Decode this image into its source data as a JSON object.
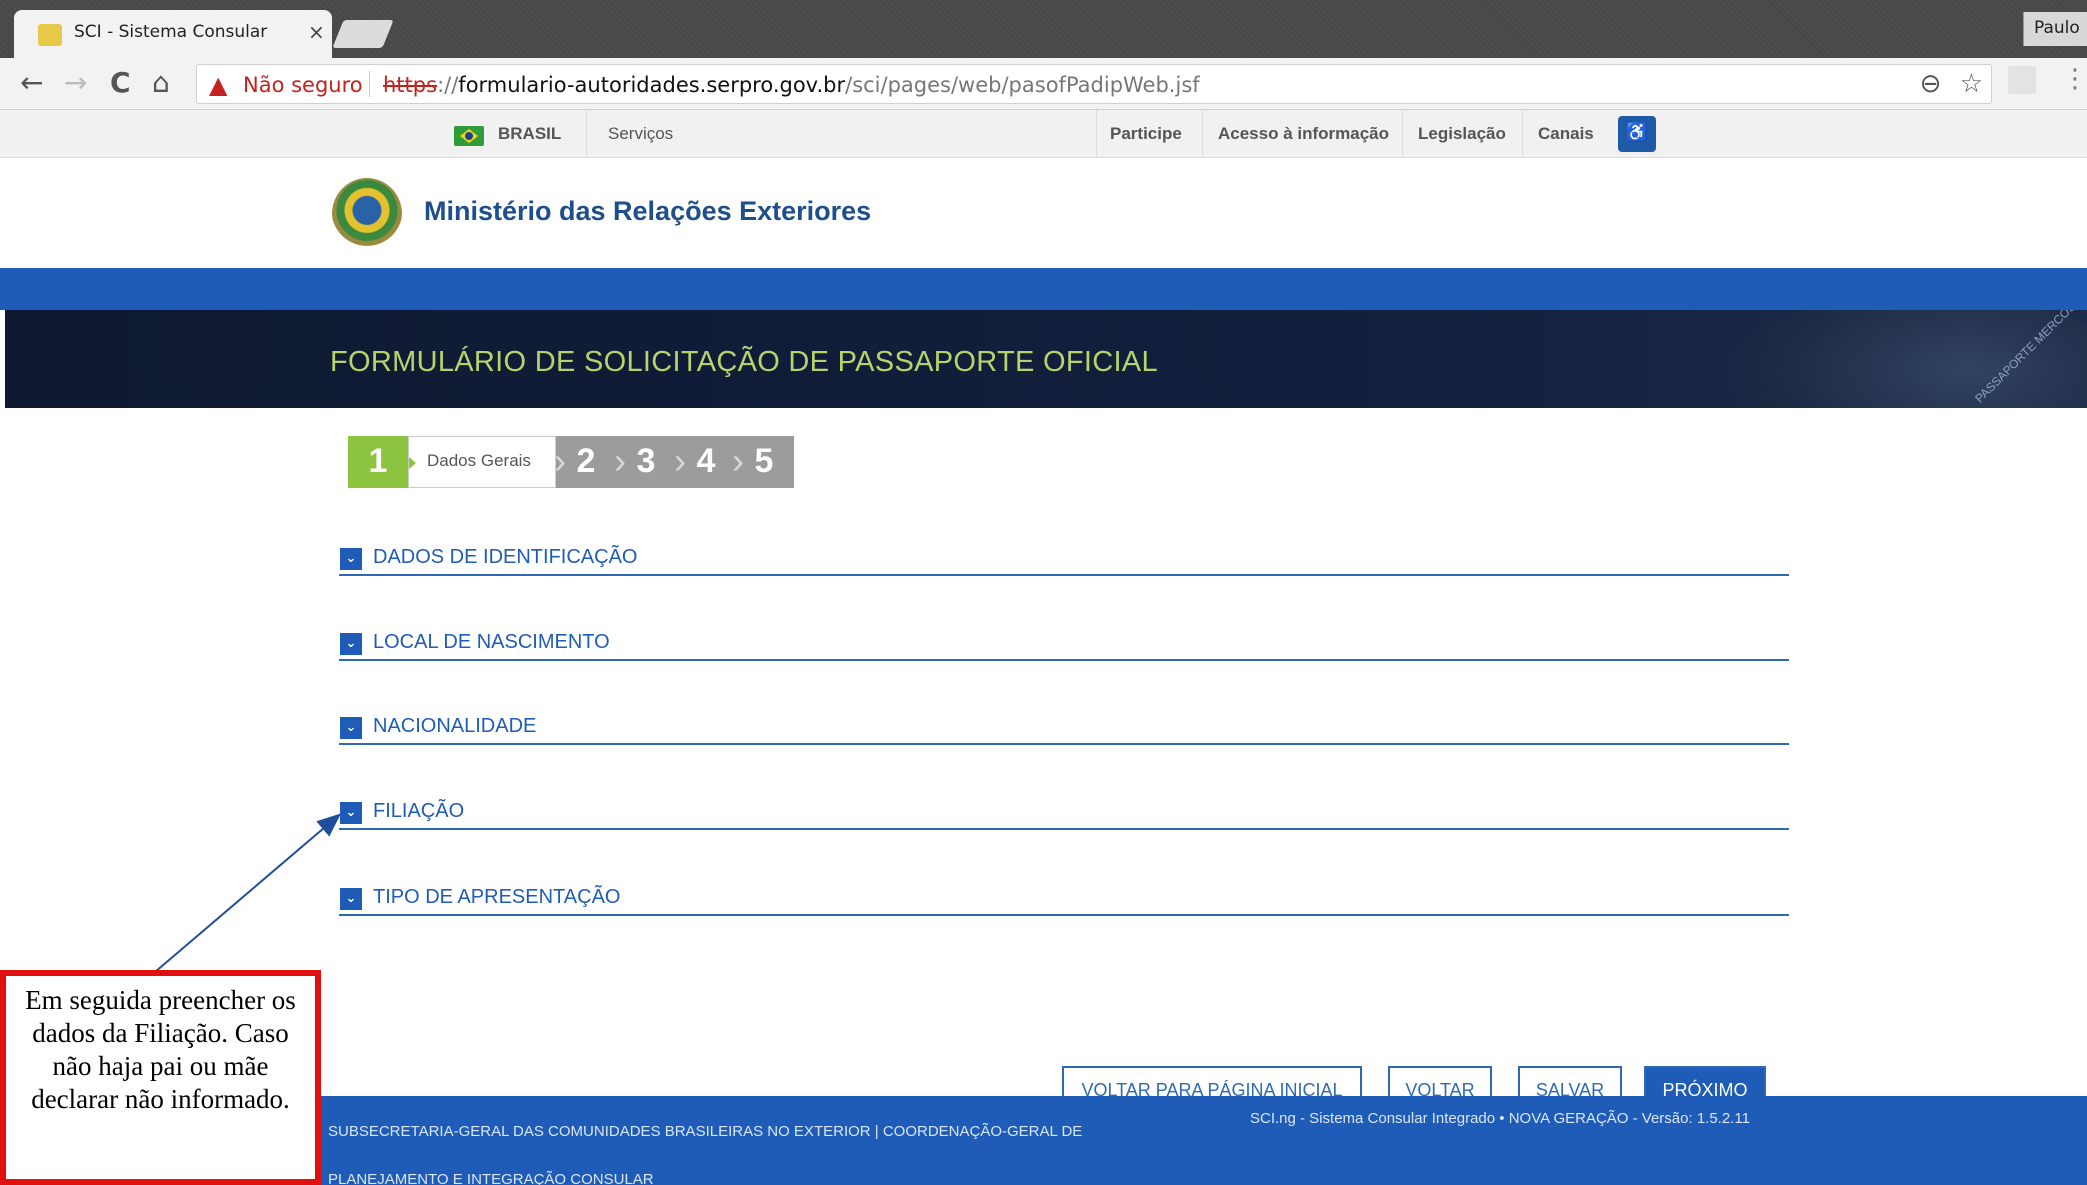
{
  "browser": {
    "tab_title": "SCI - Sistema Consular Inte",
    "tab_close": "×",
    "profile_name": "Paulo",
    "back_icon": "←",
    "forward_icon": "→",
    "reload_icon": "C",
    "home_icon": "⌂",
    "warning_icon": "▲",
    "security_label": "Não seguro",
    "url_scheme": "https",
    "url_sep": "://",
    "url_host": "formulario-autoridades.serpro.gov.br",
    "url_path": "/sci/pages/web/pasofPadipWeb.jsf",
    "zoom_icon": "⊖",
    "star_icon": "☆",
    "menu_icon": "⋮"
  },
  "govbar": {
    "brasil": "BRASIL",
    "servicos": "Serviços",
    "participe": "Participe",
    "acesso": "Acesso à informação",
    "legislacao": "Legislação",
    "canais": "Canais",
    "accessibility_icon": "♿"
  },
  "header": {
    "ministry": "Ministério das Relações Exteriores"
  },
  "banner": {
    "title": "FORMULÁRIO DE SOLICITAÇÃO DE PASSAPORTE OFICIAL",
    "art_text": "PASSAPORTE MERCOSUL"
  },
  "steps": {
    "current_number": "1",
    "current_label": "Dados Gerais",
    "others": [
      "2",
      "3",
      "4",
      "5"
    ]
  },
  "sections": [
    {
      "label": "DADOS DE IDENTIFICAÇÃO",
      "icon": "⌄"
    },
    {
      "label": "LOCAL DE NASCIMENTO",
      "icon": "⌄"
    },
    {
      "label": "NACIONALIDADE",
      "icon": "⌄"
    },
    {
      "label": "FILIAÇÃO",
      "icon": "⌄"
    },
    {
      "label": "TIPO DE APRESENTAÇÃO",
      "icon": "⌄"
    }
  ],
  "buttons": {
    "home": "VOLTAR PARA PÁGINA INICIAL",
    "back": "VOLTAR",
    "save": "SALVAR",
    "next": "PRÓXIMO"
  },
  "footer": {
    "left": "SUBSECRETARIA-GERAL DAS COMUNIDADES BRASILEIRAS NO EXTERIOR | COORDENAÇÃO-GERAL DE PLANEJAMENTO E INTEGRAÇÃO CONSULAR",
    "right": "SCI.ng - Sistema Consular Integrado • NOVA GERAÇÃO - Versão: 1.5.2.11"
  },
  "annotation": {
    "text": "Em seguida preencher os dados da Filiação. Caso não haja pai ou mãe declarar não informado."
  },
  "colors": {
    "gov_blue": "#1f5cb7",
    "banner_bg": "#0f1b33",
    "title_green": "#b7d36b",
    "step_green": "#8cc43f",
    "callout_red": "#e01010"
  }
}
